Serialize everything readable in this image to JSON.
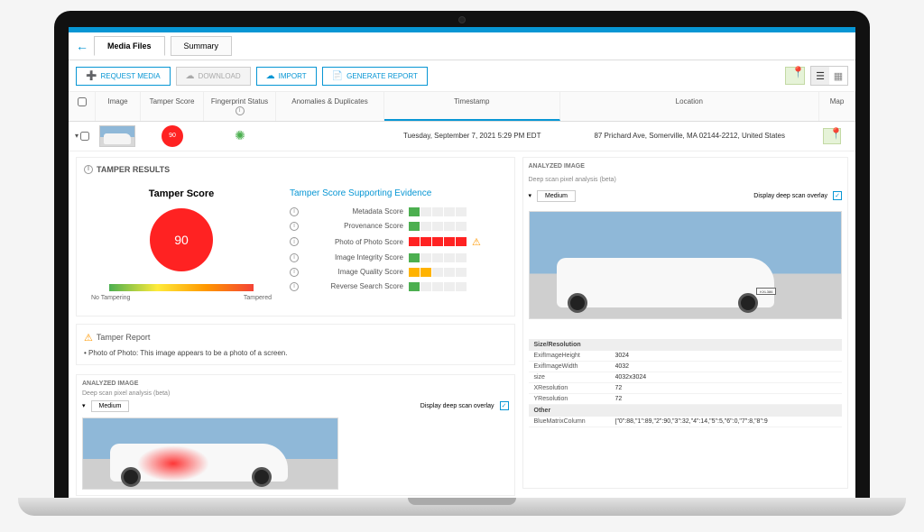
{
  "tabs": {
    "media_files": "Media Files",
    "summary": "Summary"
  },
  "actions": {
    "request_media": "REQUEST MEDIA",
    "download": "DOWNLOAD",
    "import": "IMPORT",
    "generate_report": "GENERATE REPORT"
  },
  "columns": {
    "image": "Image",
    "tamper_score": "Tamper Score",
    "fingerprint_status": "Fingerprint Status",
    "anomalies": "Anomalies & Duplicates",
    "timestamp": "Timestamp",
    "location": "Location",
    "map": "Map"
  },
  "row": {
    "score": "90",
    "timestamp": "Tuesday, September 7, 2021 5:29 PM EDT",
    "location": "87 Prichard Ave, Somerville, MA 02144-2212, United States"
  },
  "tamper_results": {
    "title": "TAMPER RESULTS",
    "score_label": "Tamper Score",
    "score_value": "90",
    "no_tampering": "No Tampering",
    "tampered": "Tampered",
    "evidence_title": "Tamper Score Supporting Evidence",
    "evidence": [
      {
        "label": "Metadata Score",
        "fill": [
          "g"
        ],
        "warn": false
      },
      {
        "label": "Provenance Score",
        "fill": [
          "g"
        ],
        "warn": false
      },
      {
        "label": "Photo of Photo Score",
        "fill": [
          "r",
          "r",
          "r",
          "r",
          "r"
        ],
        "warn": true
      },
      {
        "label": "Image Integrity Score",
        "fill": [
          "g"
        ],
        "warn": false
      },
      {
        "label": "Image Quality Score",
        "fill": [
          "y",
          "y"
        ],
        "warn": false
      },
      {
        "label": "Reverse Search Score",
        "fill": [
          "g"
        ],
        "warn": false
      }
    ]
  },
  "tamper_report": {
    "title": "Tamper Report",
    "body": "• Photo of Photo: This image appears to be a photo of a screen."
  },
  "analyzed": {
    "title": "ANALYZED IMAGE",
    "deep_note": "Deep scan pixel analysis (beta)",
    "level": "Medium",
    "overlay_label": "Display deep scan overlay",
    "plate": "KXL386"
  },
  "metadata": {
    "section1": "Size/Resolution",
    "rows1": [
      {
        "k": "ExifImageHeight",
        "v": "3024"
      },
      {
        "k": "ExifImageWidth",
        "v": "4032"
      },
      {
        "k": "size",
        "v": "4032x3024"
      },
      {
        "k": "XResolution",
        "v": "72"
      },
      {
        "k": "YResolution",
        "v": "72"
      }
    ],
    "section2": "Other",
    "rows2": [
      {
        "k": "BlueMatrixColumn",
        "v": "[\"0\":88,\"1\":89,\"2\":90,\"3\":32,\"4\":14,\"5\":5,\"6\":0,\"7\":8,\"8\":9"
      }
    ]
  }
}
